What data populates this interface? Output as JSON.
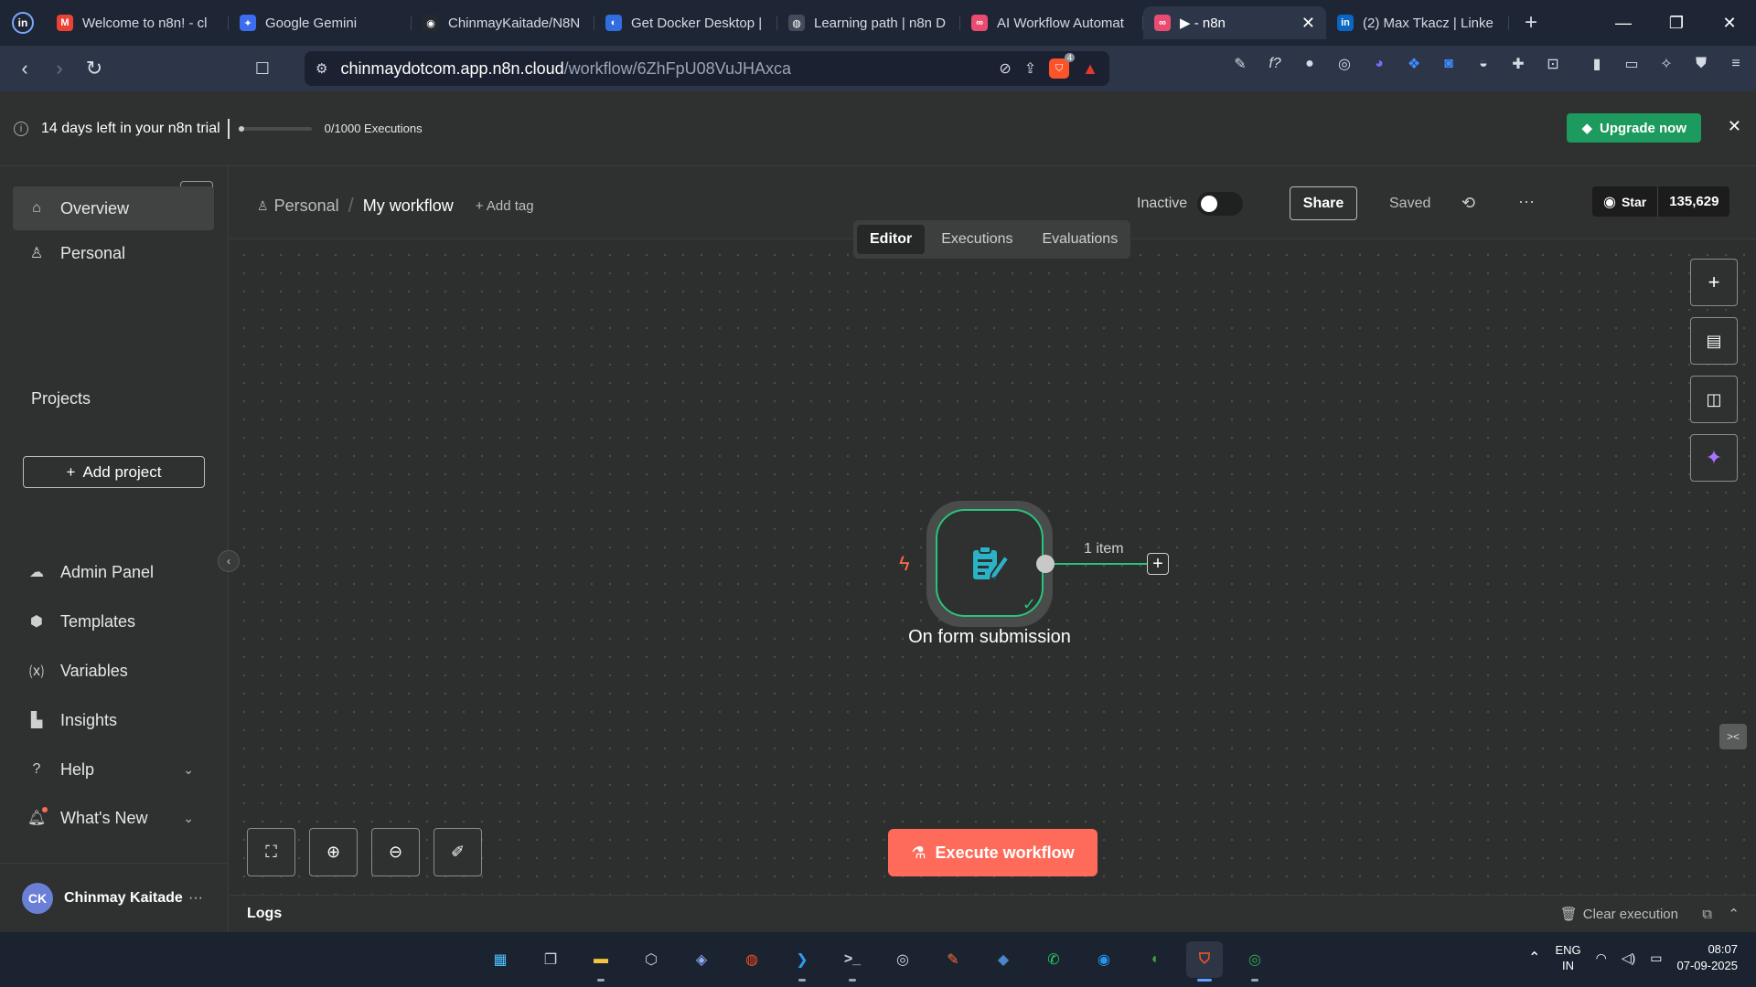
{
  "browser": {
    "tabs": [
      {
        "title": "Welcome to n8n! - cl",
        "fav_color": "#ea4335",
        "fav_text": "M"
      },
      {
        "title": "Google Gemini",
        "fav_color": "#3c6df0",
        "fav_text": "✦"
      },
      {
        "title": "ChinmayKaitade/N8N",
        "fav_color": "#24292f",
        "fav_text": "◉"
      },
      {
        "title": "Get Docker Desktop |",
        "fav_color": "#2f6de0",
        "fav_text": "◐"
      },
      {
        "title": "Learning path | n8n D",
        "fav_color": "#444c5c",
        "fav_text": "◍"
      },
      {
        "title": "AI Workflow Automat",
        "fav_color": "#ea4b71",
        "fav_text": "∞"
      },
      {
        "title": "▶ - n8n",
        "fav_color": "#ea4b71",
        "fav_text": "∞"
      },
      {
        "title": "(2) Max Tkacz | Linke",
        "fav_color": "#0a66c2",
        "fav_text": "in"
      }
    ],
    "active_tab_index": 6,
    "url_host": "chinmaydotcom.app.n8n.cloud",
    "url_path": "/workflow/6ZhFpU08VuJHAxca",
    "shield_badge": "4"
  },
  "banner": {
    "trial_text": "14 days left in your n8n trial",
    "executions": "0/1000 Executions",
    "execution_fraction": 0.0,
    "upgrade_label": "Upgrade now"
  },
  "sidebar": {
    "brand": "n8n",
    "nav_top": [
      {
        "label": "Overview",
        "icon": "home-icon"
      },
      {
        "label": "Personal",
        "icon": "user-icon"
      }
    ],
    "projects_heading": "Projects",
    "add_project_label": "Add project",
    "nav_bottom": [
      {
        "label": "Admin Panel",
        "icon": "cloud-icon"
      },
      {
        "label": "Templates",
        "icon": "box-icon"
      },
      {
        "label": "Variables",
        "icon": "variable-icon"
      },
      {
        "label": "Insights",
        "icon": "chart-icon"
      },
      {
        "label": "Help",
        "icon": "help-icon"
      },
      {
        "label": "What's New",
        "icon": "bell-icon"
      }
    ],
    "user": {
      "initials": "CK",
      "name": "Chinmay Kaitade"
    }
  },
  "workflow": {
    "project": "Personal",
    "name": "My workflow",
    "add_tag": "+ Add tag",
    "status_label": "Inactive",
    "active": false,
    "share_label": "Share",
    "saved_label": "Saved",
    "github": {
      "star_label": "Star",
      "count": "135,629"
    },
    "view_tabs": [
      "Editor",
      "Executions",
      "Evaluations"
    ],
    "active_view": "Editor"
  },
  "canvas": {
    "node_name": "On form submission",
    "edge_label": "1 item",
    "execute_label": "Execute workflow"
  },
  "logs": {
    "label": "Logs",
    "clear_label": "Clear execution"
  },
  "taskbar": {
    "apps": [
      {
        "name": "windows-start-icon",
        "color": "#4cc2ff",
        "glyph": "▦"
      },
      {
        "name": "task-view-icon",
        "color": "#d0d4dc",
        "glyph": "❐"
      },
      {
        "name": "file-explorer-icon",
        "color": "#f5c542",
        "glyph": "▬"
      },
      {
        "name": "unity-icon",
        "color": "#c8ccd4",
        "glyph": "⬡"
      },
      {
        "name": "git-icon",
        "color": "#8fb0ff",
        "glyph": "◈"
      },
      {
        "name": "figma-icon",
        "color": "#f24e1e",
        "glyph": "◍"
      },
      {
        "name": "vscode-icon",
        "color": "#2a9df4",
        "glyph": "❯"
      },
      {
        "name": "terminal-icon",
        "color": "#d0d4dc",
        "glyph": ">_"
      },
      {
        "name": "obs-icon",
        "color": "#d0d4dc",
        "glyph": "◎"
      },
      {
        "name": "postman-icon",
        "color": "#ff6c37",
        "glyph": "✎"
      },
      {
        "name": "mysql-icon",
        "color": "#4b86c8",
        "glyph": "◆"
      },
      {
        "name": "whatsapp-icon",
        "color": "#25d366",
        "glyph": "✆"
      },
      {
        "name": "docker-icon",
        "color": "#2496ed",
        "glyph": "◉"
      },
      {
        "name": "mongodb-icon",
        "color": "#47a248",
        "glyph": "◖"
      },
      {
        "name": "brave-icon",
        "color": "#fb542b",
        "glyph": "⛉"
      },
      {
        "name": "chrome-icon",
        "color": "#34a853",
        "glyph": "◎"
      }
    ],
    "active_app": "brave-icon",
    "running": [
      "file-explorer-icon",
      "vscode-icon",
      "terminal-icon",
      "brave-icon",
      "chrome-icon"
    ],
    "lang_top": "ENG",
    "lang_bottom": "IN",
    "time": "08:07",
    "date": "07-09-2025"
  },
  "colors": {
    "accent_green": "#29c47a",
    "execute_orange": "#ff6b5b",
    "upgrade_green": "#1d9a5e",
    "brand_pink": "#ea4b71"
  }
}
